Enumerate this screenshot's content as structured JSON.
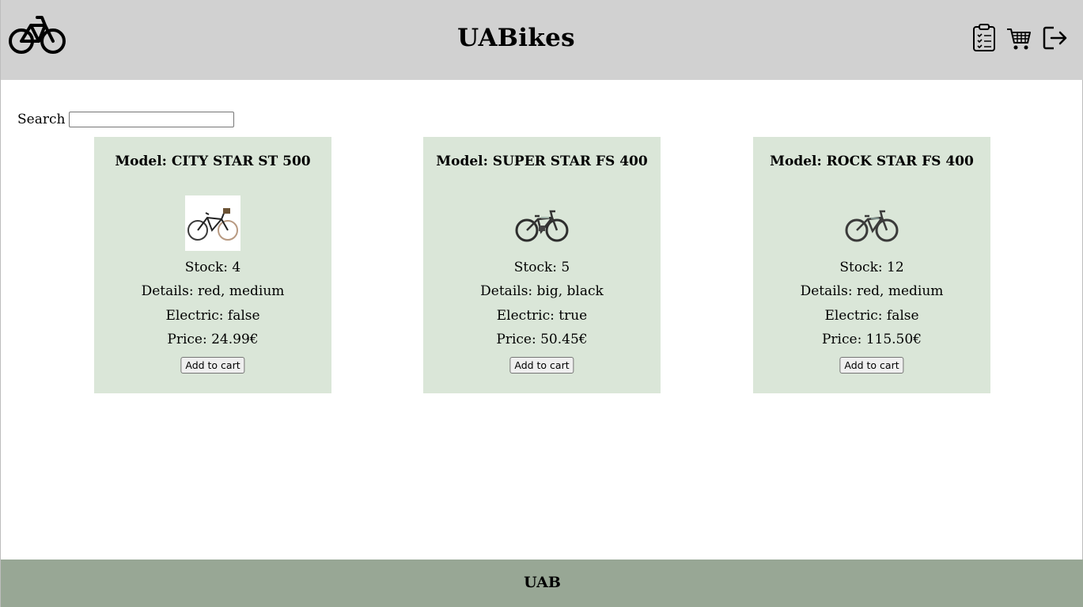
{
  "header": {
    "title": "UABikes",
    "logo_icon": "bicycle-icon",
    "icons": [
      "orders-clipboard-icon",
      "cart-icon",
      "logout-icon"
    ]
  },
  "search": {
    "label": "Search",
    "value": "",
    "placeholder": ""
  },
  "products": [
    {
      "model": "Model: CITY STAR ST 500",
      "stock": "Stock: 4",
      "details": "Details: red, medium",
      "electric": "Electric: false",
      "price": "Price: 24.99€",
      "button": "Add to cart"
    },
    {
      "model": "Model: SUPER STAR FS 400",
      "stock": "Stock: 5",
      "details": "Details: big, black",
      "electric": "Electric: true",
      "price": "Price: 50.45€",
      "button": "Add to cart"
    },
    {
      "model": "Model: ROCK STAR FS 400",
      "stock": "Stock: 12",
      "details": "Details: red, medium",
      "electric": "Electric: false",
      "price": "Price: 115.50€",
      "button": "Add to cart"
    }
  ],
  "footer": {
    "text": "UAB"
  },
  "colors": {
    "header_bg": "#d1d1d1",
    "card_bg": "#dae6d8",
    "footer_bg": "#98a795"
  }
}
